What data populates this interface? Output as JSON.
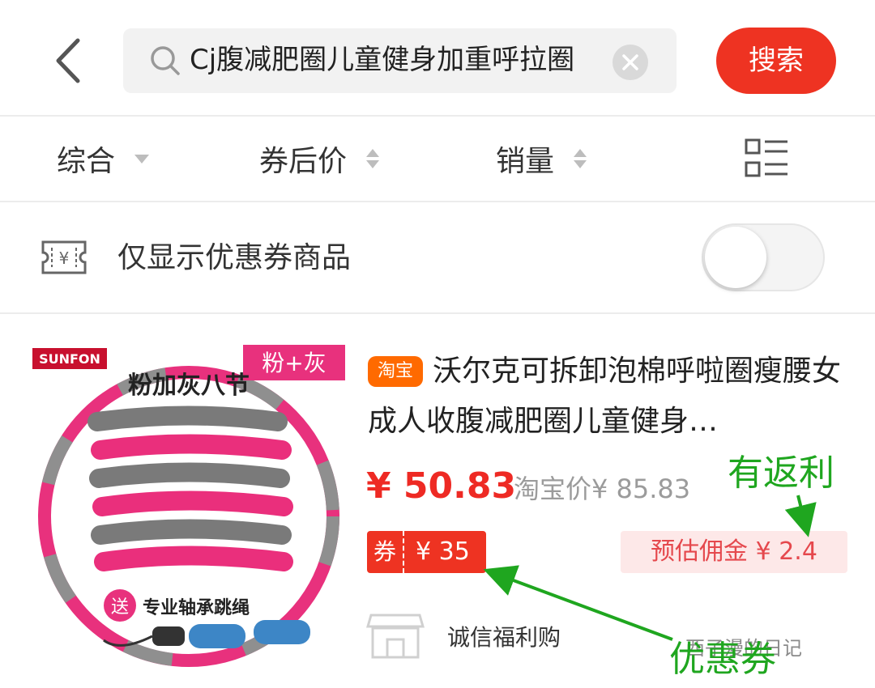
{
  "header": {
    "search_query": "Cj腹减肥圈儿童健身加重呼拉圈",
    "search_button": "搜索"
  },
  "sortbar": {
    "items": [
      {
        "label": "综合"
      },
      {
        "label": "券后价"
      },
      {
        "label": "销量"
      }
    ]
  },
  "filter": {
    "label": "仅显示优惠券商品",
    "toggle_on": false
  },
  "product": {
    "platform_badge": "淘宝",
    "title": "沃尔克可拆卸泡棉呼啦圈瘦腰女成人收腹减肥圈儿童健身…",
    "price": "¥ 50.83",
    "original_price": "淘宝价¥ 85.83",
    "coupon_tag": "券",
    "coupon_value": "¥ 35",
    "commission": "预估佣金 ¥ 2.4",
    "shop_name": "诚信福利购",
    "image": {
      "brand": "SUNFON",
      "corner_label": "粉+灰",
      "headline": "粉加灰八节",
      "gift_badge": "送",
      "gift_text": "专业轴承跳绳"
    }
  },
  "annotations": {
    "rebate": "有返利",
    "coupon": "优惠券"
  },
  "watermark": "西子漫的日记",
  "colors": {
    "accent_red": "#ee3322",
    "taobao_orange": "#ff6a00",
    "annotation_green": "#1fa61f"
  }
}
